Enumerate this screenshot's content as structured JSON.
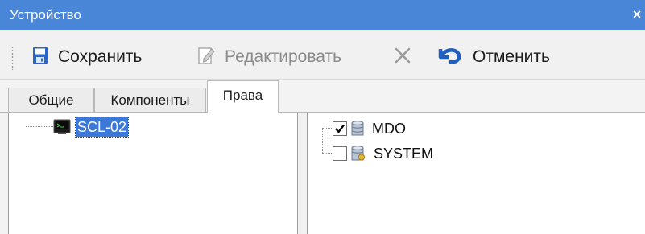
{
  "window": {
    "title": "Устройство",
    "close_glyph": "×"
  },
  "toolbar": {
    "save_label": "Сохранить",
    "edit_label": "Редактировать",
    "delete_label": "",
    "cancel_label": "Отменить",
    "icons": {
      "save": "floppy-disk-icon",
      "edit": "pencil-document-icon",
      "delete": "x-mark-icon",
      "cancel": "undo-arrow-icon"
    }
  },
  "tabs": [
    {
      "label": "Общие",
      "active": false
    },
    {
      "label": "Компоненты",
      "active": false
    },
    {
      "label": "Права",
      "active": true
    }
  ],
  "device_tree": {
    "items": [
      {
        "label": "SCL-02",
        "selected": true,
        "icon": "terminal-device-icon"
      }
    ]
  },
  "rights_tree": {
    "items": [
      {
        "label": "MDO",
        "checked": true,
        "icon": "database-icon"
      },
      {
        "label": "SYSTEM",
        "checked": false,
        "icon": "database-key-icon"
      }
    ]
  },
  "colors": {
    "titlebar": "#4a86d8",
    "selection": "#3b78d8",
    "cancel_icon": "#1f5fbf"
  }
}
